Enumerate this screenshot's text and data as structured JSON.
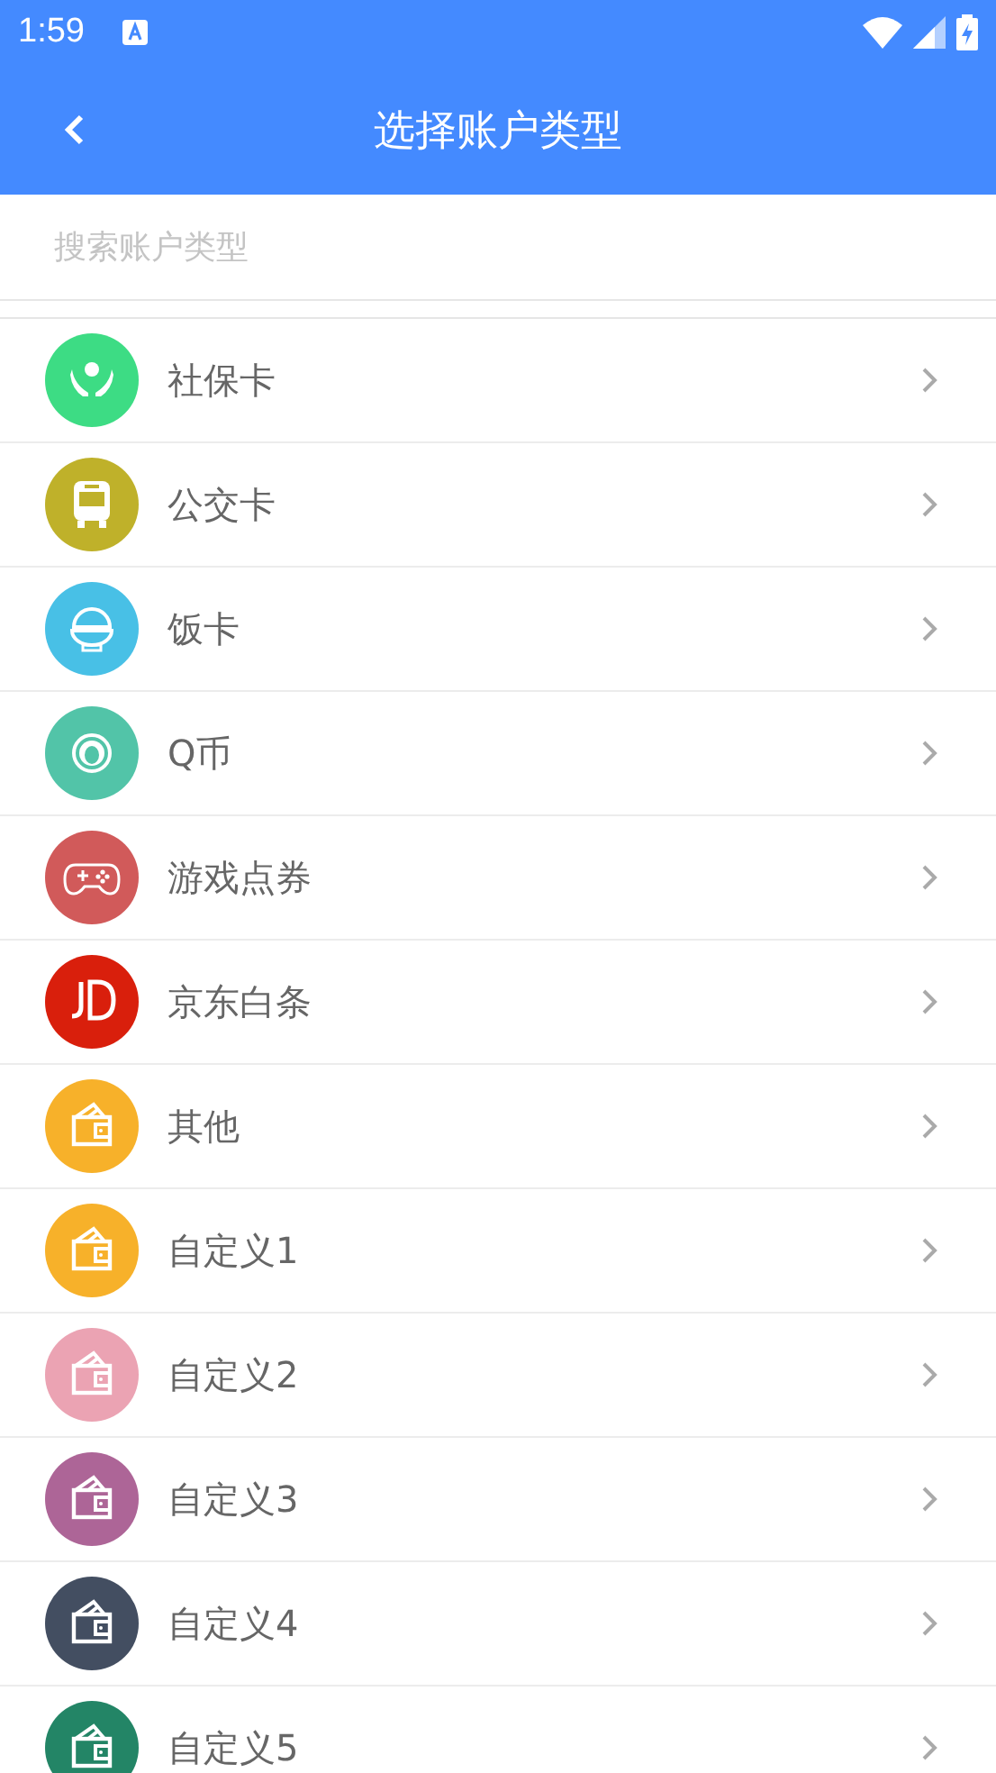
{
  "status_bar": {
    "time": "1:59"
  },
  "toolbar": {
    "title": "选择账户类型"
  },
  "search": {
    "placeholder": "搜索账户类型"
  },
  "items": [
    {
      "label": "社保卡",
      "kind": "hands",
      "color": "#3ddc84"
    },
    {
      "label": "公交卡",
      "kind": "bus",
      "color": "#bfb12a"
    },
    {
      "label": "饭卡",
      "kind": "bowl",
      "color": "#48c0e6"
    },
    {
      "label": "Q币",
      "kind": "penguin",
      "color": "#52c4a8"
    },
    {
      "label": "游戏点券",
      "kind": "gamepad",
      "color": "#d15a5a"
    },
    {
      "label": "京东白条",
      "kind": "jd",
      "color": "#d91f0c"
    },
    {
      "label": "其他",
      "kind": "wallet",
      "color": "#f7b12a"
    },
    {
      "label": "自定义1",
      "kind": "wallet",
      "color": "#f7b12a"
    },
    {
      "label": "自定义2",
      "kind": "wallet",
      "color": "#eba3b3"
    },
    {
      "label": "自定义3",
      "kind": "wallet",
      "color": "#ad6597"
    },
    {
      "label": "自定义4",
      "kind": "wallet",
      "color": "#434e61"
    },
    {
      "label": "自定义5",
      "kind": "wallet",
      "color": "#238566"
    }
  ]
}
